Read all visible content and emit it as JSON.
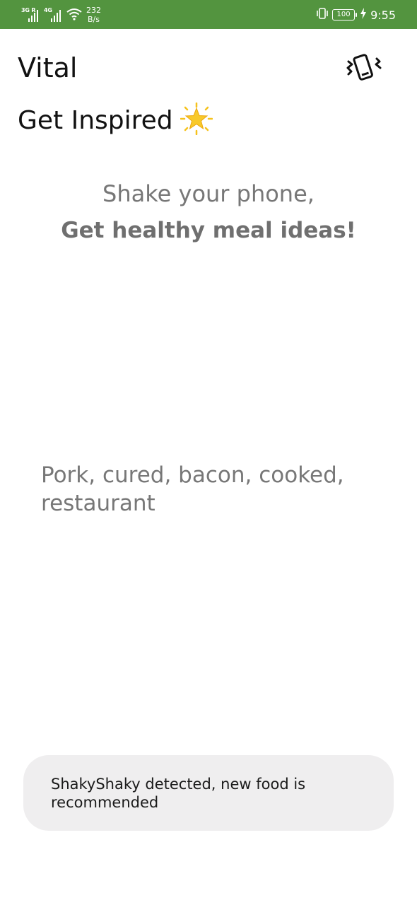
{
  "status_bar": {
    "sim1_label": "3G R",
    "sim2_label": "4G",
    "net_speed_value": "232",
    "net_speed_unit": "B/s",
    "battery": "100",
    "time": "9:55",
    "icons": [
      "signal-icon",
      "wifi-icon",
      "vibrate-icon",
      "battery-icon",
      "charging-icon"
    ]
  },
  "app": {
    "title": "Vital"
  },
  "header": {
    "shake_icon": "phone-shake-icon"
  },
  "section": {
    "heading": "Get Inspired",
    "emoji": "star-emoji"
  },
  "prompt": {
    "line1": "Shake your phone,",
    "line2": "Get healthy meal ideas!"
  },
  "recommendation": {
    "food_name": "Pork, cured, bacon, cooked, restaurant"
  },
  "toast": {
    "message": "ShakyShaky detected, new food is recommended"
  },
  "colors": {
    "status_bar": "#53943f",
    "text_primary": "#111111",
    "text_muted": "#777777",
    "toast_bg": "#efeeef",
    "star": "#f6c21c"
  }
}
